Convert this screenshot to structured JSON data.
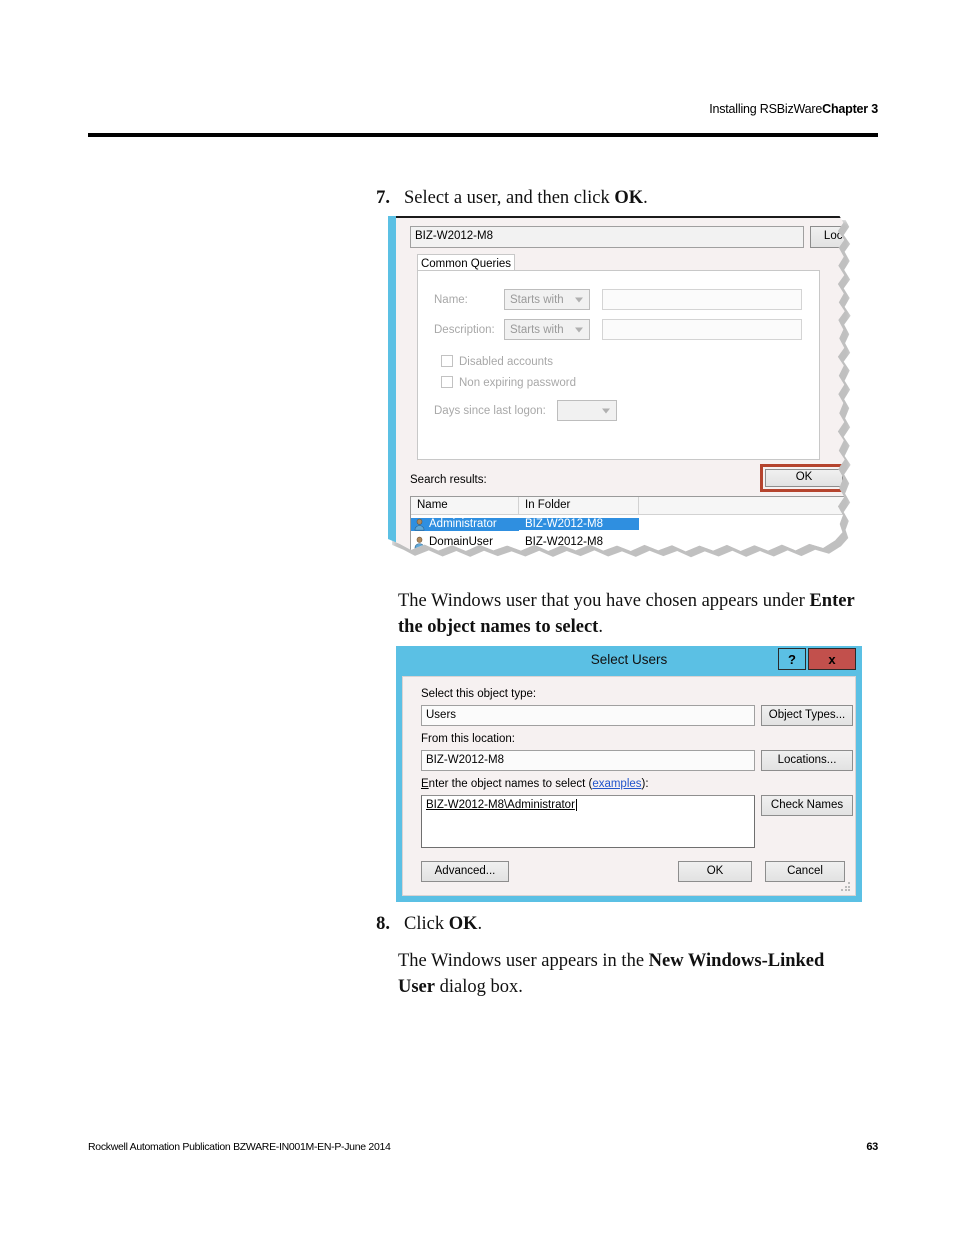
{
  "page": {
    "header_text": "Installing RSBizWare",
    "header_chapter": "Chapter 3",
    "footer_text": "Rockwell Automation Publication BZWARE-IN001M-EN-P-June 2014",
    "page_number": "63"
  },
  "steps": {
    "step7": {
      "number": "7.",
      "text_before": "Select a user, and then click ",
      "text_bold": "OK",
      "text_after": "."
    },
    "step8": {
      "number": "8.",
      "text_before": "Click ",
      "text_bold": "OK",
      "text_after": "."
    }
  },
  "paragraphs": {
    "after_fig1_before": "The Windows user that you have chosen appears under ",
    "after_fig1_bold": "Enter the object names to select",
    "after_fig1_after": ".",
    "after_fig2_before": "The Windows user appears in the ",
    "after_fig2_bold": "New Windows-Linked User",
    "after_fig2_after": " dialog box."
  },
  "find_dialog": {
    "location_value": "BIZ-W2012-M8",
    "locations_button": "Locat",
    "tab_label": "Common Queries",
    "name_label": "Name:",
    "name_operator": "Starts with",
    "name_value": "",
    "description_label": "Description:",
    "description_operator": "Starts with",
    "description_value": "",
    "disabled_accounts_label": "Disabled accounts",
    "non_expiring_label": "Non expiring password",
    "days_since_label": "Days since last logon:",
    "days_since_value": "",
    "ok_button": "OK",
    "search_results_label": "Search results:",
    "columns": [
      "Name",
      "In Folder"
    ],
    "rows": [
      {
        "name": "Administrator",
        "folder": "BIZ-W2012-M8",
        "selected": true
      },
      {
        "name": "DomainUser",
        "folder": "BIZ-W2012-M8",
        "selected": false
      }
    ],
    "callout_color": "#b5442e",
    "window_border_color": "#5bc0e4",
    "selection_color": "#2f8fe0"
  },
  "select_users_dialog": {
    "title": "Select Users",
    "help_button": "?",
    "close_button": "x",
    "object_type_label": "Select this object type:",
    "object_type_value": "Users",
    "object_types_button": "Object Types...",
    "location_label": "From this location:",
    "location_value": "BIZ-W2012-M8",
    "locations_button": "Locations...",
    "names_label_prefix": "E",
    "names_label_rest": "nter the object names to select (",
    "names_label_link": "examples",
    "names_label_suffix": "):",
    "names_value": "BIZ-W2012-M8\\Administrator",
    "check_names_button": "Check Names",
    "advanced_button": "Advanced...",
    "ok_button": "OK",
    "cancel_button": "Cancel",
    "titlebar_color": "#5bc0e4",
    "close_color": "#c2504c"
  }
}
